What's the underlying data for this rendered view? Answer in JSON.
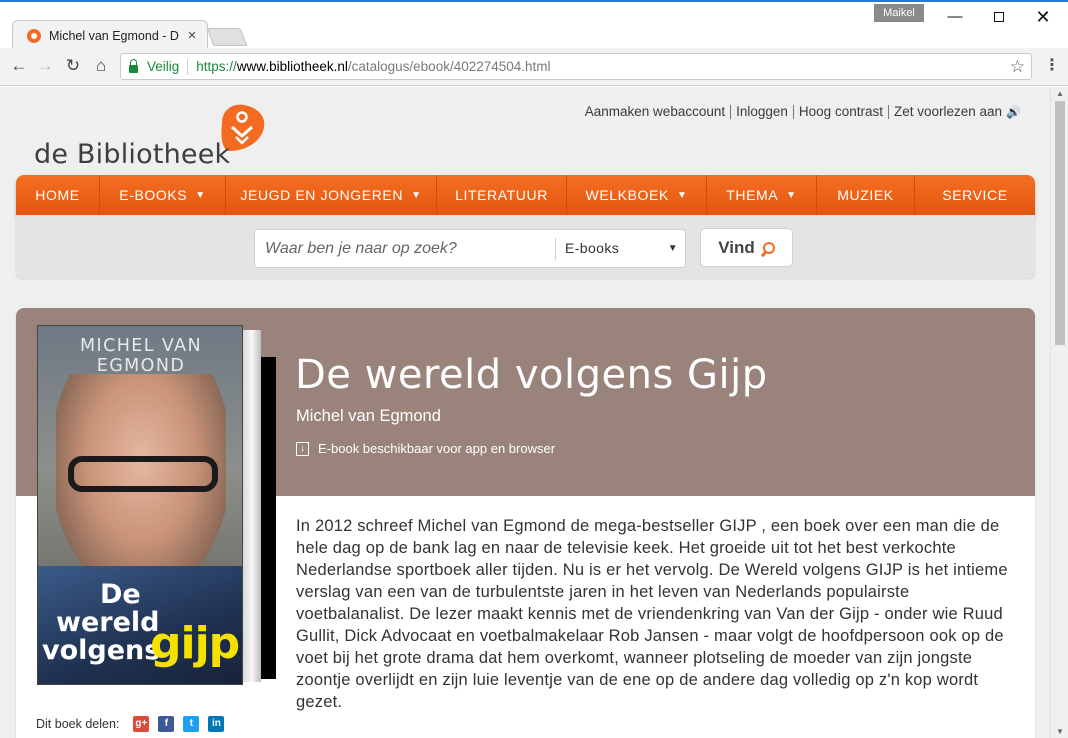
{
  "browser": {
    "tab_title": "Michel van Egmond - De",
    "tab_close": "×",
    "profile_name": "Maikel",
    "secure_label": "Veilig",
    "url_protocol": "https://",
    "url_host": "www.bibliotheek.nl",
    "url_path": "/catalogus/ebook/402274504.html"
  },
  "site": {
    "logo_text": "de Bibliotheek",
    "brand_color": "#f26b21",
    "top_links": [
      "Aanmaken webaccount",
      "Inloggen",
      "Hoog contrast",
      "Zet voorlezen aan"
    ],
    "nav": [
      {
        "label": "HOME",
        "has_dropdown": false
      },
      {
        "label": "E-BOOKS",
        "has_dropdown": true
      },
      {
        "label": "JEUGD EN JONGEREN",
        "has_dropdown": true
      },
      {
        "label": "LITERATUUR",
        "has_dropdown": false
      },
      {
        "label": "WELKBOEK",
        "has_dropdown": true
      },
      {
        "label": "THEMA",
        "has_dropdown": true
      },
      {
        "label": "MUZIEK",
        "has_dropdown": false
      },
      {
        "label": "SERVICE",
        "has_dropdown": false
      }
    ],
    "search": {
      "placeholder": "Waar ben je naar op zoek?",
      "category": "E-books",
      "button": "Vind"
    }
  },
  "book": {
    "title": "De wereld volgens Gijp",
    "author": "Michel van Egmond",
    "format_note": "E-book beschikbaar voor app en browser",
    "hero_color": "#9a837a",
    "cover": {
      "author_text": "MICHEL VAN EGMOND",
      "title_line1": "De",
      "title_line2": "wereld",
      "title_line3": "volgens",
      "title_word": "gijp"
    },
    "description": "In 2012 schreef Michel van Egmond de mega-bestseller GIJP , een boek over een man die de hele dag op de bank lag en naar de televisie keek. Het groeide uit tot het best verkochte Nederlandse sportboek aller tijden. Nu is er het vervolg. De Wereld volgens GIJP is het intieme verslag van een van de turbulentste jaren in het leven van Nederlands populairste voetbalanalist. De lezer maakt kennis met de vriendenkring van Van der Gijp - onder wie Ruud Gullit, Dick Advocaat en voetbalmakelaar Rob Jansen - maar volgt de hoofdpersoon ook op de voet bij het grote drama dat hem overkomt, wanneer plotseling de moeder van zijn jongste zoontje overlijdt en zijn luie leventje van de ene op de andere dag volledig op z'n kop wordt gezet.",
    "share_label": "Dit boek delen:"
  }
}
